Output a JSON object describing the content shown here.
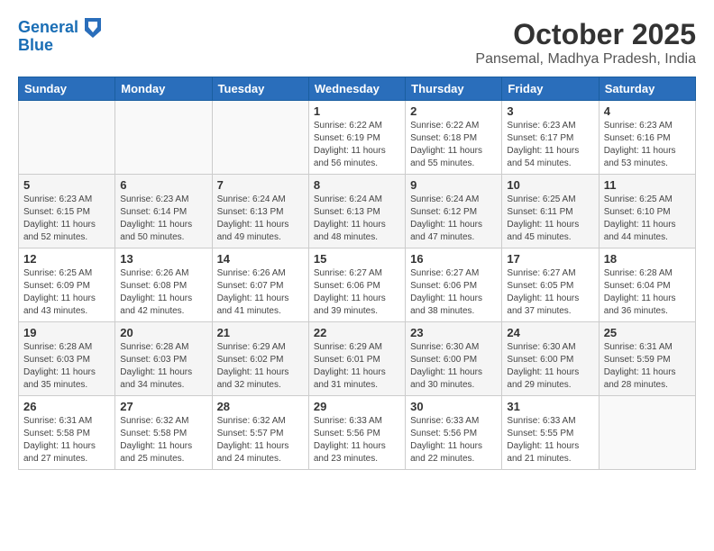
{
  "logo": {
    "line1": "General",
    "line2": "Blue"
  },
  "title": "October 2025",
  "location": "Pansemal, Madhya Pradesh, India",
  "weekdays": [
    "Sunday",
    "Monday",
    "Tuesday",
    "Wednesday",
    "Thursday",
    "Friday",
    "Saturday"
  ],
  "weeks": [
    [
      {
        "day": "",
        "info": ""
      },
      {
        "day": "",
        "info": ""
      },
      {
        "day": "",
        "info": ""
      },
      {
        "day": "1",
        "info": "Sunrise: 6:22 AM\nSunset: 6:19 PM\nDaylight: 11 hours\nand 56 minutes."
      },
      {
        "day": "2",
        "info": "Sunrise: 6:22 AM\nSunset: 6:18 PM\nDaylight: 11 hours\nand 55 minutes."
      },
      {
        "day": "3",
        "info": "Sunrise: 6:23 AM\nSunset: 6:17 PM\nDaylight: 11 hours\nand 54 minutes."
      },
      {
        "day": "4",
        "info": "Sunrise: 6:23 AM\nSunset: 6:16 PM\nDaylight: 11 hours\nand 53 minutes."
      }
    ],
    [
      {
        "day": "5",
        "info": "Sunrise: 6:23 AM\nSunset: 6:15 PM\nDaylight: 11 hours\nand 52 minutes."
      },
      {
        "day": "6",
        "info": "Sunrise: 6:23 AM\nSunset: 6:14 PM\nDaylight: 11 hours\nand 50 minutes."
      },
      {
        "day": "7",
        "info": "Sunrise: 6:24 AM\nSunset: 6:13 PM\nDaylight: 11 hours\nand 49 minutes."
      },
      {
        "day": "8",
        "info": "Sunrise: 6:24 AM\nSunset: 6:13 PM\nDaylight: 11 hours\nand 48 minutes."
      },
      {
        "day": "9",
        "info": "Sunrise: 6:24 AM\nSunset: 6:12 PM\nDaylight: 11 hours\nand 47 minutes."
      },
      {
        "day": "10",
        "info": "Sunrise: 6:25 AM\nSunset: 6:11 PM\nDaylight: 11 hours\nand 45 minutes."
      },
      {
        "day": "11",
        "info": "Sunrise: 6:25 AM\nSunset: 6:10 PM\nDaylight: 11 hours\nand 44 minutes."
      }
    ],
    [
      {
        "day": "12",
        "info": "Sunrise: 6:25 AM\nSunset: 6:09 PM\nDaylight: 11 hours\nand 43 minutes."
      },
      {
        "day": "13",
        "info": "Sunrise: 6:26 AM\nSunset: 6:08 PM\nDaylight: 11 hours\nand 42 minutes."
      },
      {
        "day": "14",
        "info": "Sunrise: 6:26 AM\nSunset: 6:07 PM\nDaylight: 11 hours\nand 41 minutes."
      },
      {
        "day": "15",
        "info": "Sunrise: 6:27 AM\nSunset: 6:06 PM\nDaylight: 11 hours\nand 39 minutes."
      },
      {
        "day": "16",
        "info": "Sunrise: 6:27 AM\nSunset: 6:06 PM\nDaylight: 11 hours\nand 38 minutes."
      },
      {
        "day": "17",
        "info": "Sunrise: 6:27 AM\nSunset: 6:05 PM\nDaylight: 11 hours\nand 37 minutes."
      },
      {
        "day": "18",
        "info": "Sunrise: 6:28 AM\nSunset: 6:04 PM\nDaylight: 11 hours\nand 36 minutes."
      }
    ],
    [
      {
        "day": "19",
        "info": "Sunrise: 6:28 AM\nSunset: 6:03 PM\nDaylight: 11 hours\nand 35 minutes."
      },
      {
        "day": "20",
        "info": "Sunrise: 6:28 AM\nSunset: 6:03 PM\nDaylight: 11 hours\nand 34 minutes."
      },
      {
        "day": "21",
        "info": "Sunrise: 6:29 AM\nSunset: 6:02 PM\nDaylight: 11 hours\nand 32 minutes."
      },
      {
        "day": "22",
        "info": "Sunrise: 6:29 AM\nSunset: 6:01 PM\nDaylight: 11 hours\nand 31 minutes."
      },
      {
        "day": "23",
        "info": "Sunrise: 6:30 AM\nSunset: 6:00 PM\nDaylight: 11 hours\nand 30 minutes."
      },
      {
        "day": "24",
        "info": "Sunrise: 6:30 AM\nSunset: 6:00 PM\nDaylight: 11 hours\nand 29 minutes."
      },
      {
        "day": "25",
        "info": "Sunrise: 6:31 AM\nSunset: 5:59 PM\nDaylight: 11 hours\nand 28 minutes."
      }
    ],
    [
      {
        "day": "26",
        "info": "Sunrise: 6:31 AM\nSunset: 5:58 PM\nDaylight: 11 hours\nand 27 minutes."
      },
      {
        "day": "27",
        "info": "Sunrise: 6:32 AM\nSunset: 5:58 PM\nDaylight: 11 hours\nand 25 minutes."
      },
      {
        "day": "28",
        "info": "Sunrise: 6:32 AM\nSunset: 5:57 PM\nDaylight: 11 hours\nand 24 minutes."
      },
      {
        "day": "29",
        "info": "Sunrise: 6:33 AM\nSunset: 5:56 PM\nDaylight: 11 hours\nand 23 minutes."
      },
      {
        "day": "30",
        "info": "Sunrise: 6:33 AM\nSunset: 5:56 PM\nDaylight: 11 hours\nand 22 minutes."
      },
      {
        "day": "31",
        "info": "Sunrise: 6:33 AM\nSunset: 5:55 PM\nDaylight: 11 hours\nand 21 minutes."
      },
      {
        "day": "",
        "info": ""
      }
    ]
  ]
}
